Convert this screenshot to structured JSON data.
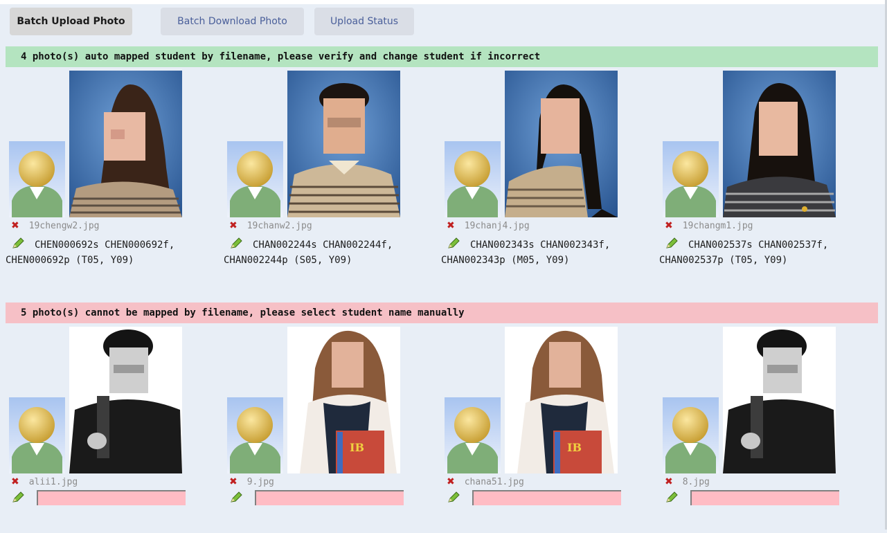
{
  "tabs": {
    "upload": "Batch Upload Photo",
    "download": "Batch Download Photo",
    "status": "Upload Status"
  },
  "mapped": {
    "banner": "4 photo(s) auto mapped student by filename, please verify and change student if incorrect",
    "items": [
      {
        "filename": "19chengw2.jpg",
        "ids": "CHEN000692s CHEN000692f,",
        "line2": "CHEN000692p  (T05, Y09)"
      },
      {
        "filename": "19chanw2.jpg",
        "ids": "CHAN002244s CHAN002244f,",
        "line2": "CHAN002244p  (S05, Y09)"
      },
      {
        "filename": "19chanj4.jpg",
        "ids": "CHAN002343s CHAN002343f,",
        "line2": "CHAN002343p  (M05, Y09)"
      },
      {
        "filename": "19changm1.jpg",
        "ids": "CHAN002537s CHAN002537f,",
        "line2": "CHAN002537p  (T05, Y09)"
      }
    ]
  },
  "unmapped": {
    "banner": "5 photo(s) cannot be mapped by filename, please select student name manually",
    "items": [
      {
        "filename": "alii1.jpg",
        "student_value": ""
      },
      {
        "filename": "9.jpg",
        "student_value": ""
      },
      {
        "filename": "chana51.jpg",
        "student_value": ""
      },
      {
        "filename": "8.jpg",
        "student_value": ""
      }
    ]
  },
  "colors": {
    "mapped_banner": "#b4e4c0",
    "unmapped_banner": "#f6c0c6",
    "delete_icon": "#c02020",
    "input_bg": "#ffbcc4"
  },
  "icons": {
    "delete": "close-x-icon",
    "edit": "pencil-icon",
    "placeholder": "default-avatar-icon"
  }
}
